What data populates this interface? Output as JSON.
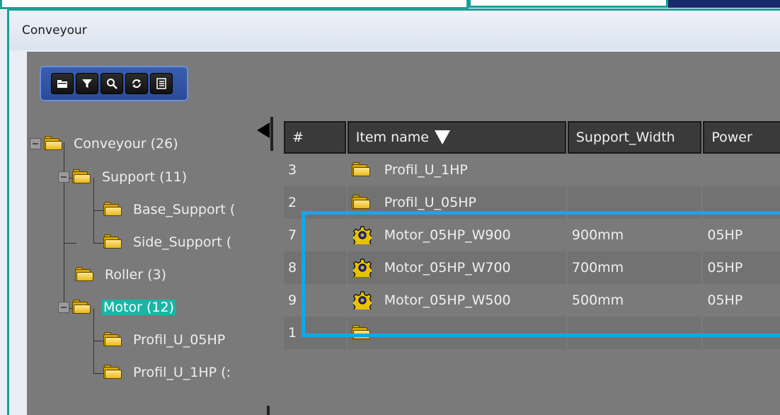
{
  "window": {
    "title": "Conveyour"
  },
  "toolbar": {
    "buttons": [
      {
        "icon": "folder-icon"
      },
      {
        "icon": "filter-icon"
      },
      {
        "icon": "search-icon"
      },
      {
        "icon": "refresh-icon"
      },
      {
        "icon": "list-icon"
      }
    ]
  },
  "tree": {
    "root": {
      "label": "Conveyour (26)"
    },
    "support": {
      "label": "Support (11)"
    },
    "base_support": {
      "label": "Base_Support ("
    },
    "side_support": {
      "label": "Side_Support ("
    },
    "roller": {
      "label": "Roller (3)"
    },
    "motor": {
      "label": "Motor (12)"
    },
    "profil_05hp": {
      "label": "Profil_U_05HP"
    },
    "profil_1hp": {
      "label": "Profil_U_1HP (:"
    }
  },
  "table": {
    "headers": {
      "num": "#",
      "item_name": "Item name",
      "support_width": "Support_Width",
      "power": "Power"
    },
    "rows": [
      {
        "num": "3",
        "icon": "folder-icon",
        "name": "Profil_U_1HP",
        "width": "",
        "power": ""
      },
      {
        "num": "2",
        "icon": "folder-icon",
        "name": "Profil_U_05HP",
        "width": "",
        "power": ""
      },
      {
        "num": "7",
        "icon": "gear-icon",
        "name": "Motor_05HP_W900",
        "width": "900mm",
        "power": "05HP"
      },
      {
        "num": "8",
        "icon": "gear-icon",
        "name": "Motor_05HP_W700",
        "width": "700mm",
        "power": "05HP"
      },
      {
        "num": "9",
        "icon": "gear-icon",
        "name": "Motor_05HP_W500",
        "width": "500mm",
        "power": "05HP"
      },
      {
        "num": "1",
        "icon": "folder-icon",
        "name": "..",
        "width": "",
        "power": ""
      }
    ]
  },
  "colors": {
    "accent": "#17a096",
    "selection": "#12a7e6",
    "selected_node": "#1ab5a6",
    "panel": "#7a7a7a"
  }
}
